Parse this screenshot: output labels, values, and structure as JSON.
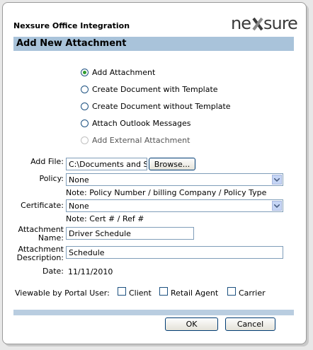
{
  "window": {
    "app_title": "Nexsure Office Integration",
    "logo_text": "nexsure"
  },
  "header": {
    "title": "Add New Attachment"
  },
  "options": [
    {
      "label": "Add Attachment",
      "checked": true,
      "disabled": false
    },
    {
      "label": "Create Document with Template",
      "checked": false,
      "disabled": false
    },
    {
      "label": "Create Document without Template",
      "checked": false,
      "disabled": false
    },
    {
      "label": "Attach Outlook Messages",
      "checked": false,
      "disabled": false
    },
    {
      "label": "Add External Attachment",
      "checked": false,
      "disabled": true
    }
  ],
  "form": {
    "add_file_label": "Add File:",
    "add_file_value": "C:\\Documents and Settings",
    "browse_label": "Browse...",
    "policy_label": "Policy:",
    "policy_value": "None",
    "policy_note": "Note: Policy Number / billing Company / Policy Type",
    "certificate_label": "Certificate:",
    "certificate_value": "None",
    "certificate_note": "Note: Cert # / Ref #",
    "attachment_name_label_1": "Attachment",
    "attachment_name_label_2": "Name:",
    "attachment_name_value": "Driver Schedule",
    "attachment_desc_label_1": "Attachment",
    "attachment_desc_label_2": "Description:",
    "attachment_desc_value": "Schedule",
    "date_label": "Date:",
    "date_value": "11/11/2010",
    "viewable_label": "Viewable by Portal User:",
    "viewable": [
      {
        "label": "Client",
        "checked": false
      },
      {
        "label": "Retail Agent",
        "checked": false
      },
      {
        "label": "Carrier",
        "checked": false
      }
    ]
  },
  "buttons": {
    "ok": "OK",
    "cancel": "Cancel"
  },
  "colors": {
    "header_bg": "#a9c3da",
    "accent_green": "#2f9c2f"
  }
}
